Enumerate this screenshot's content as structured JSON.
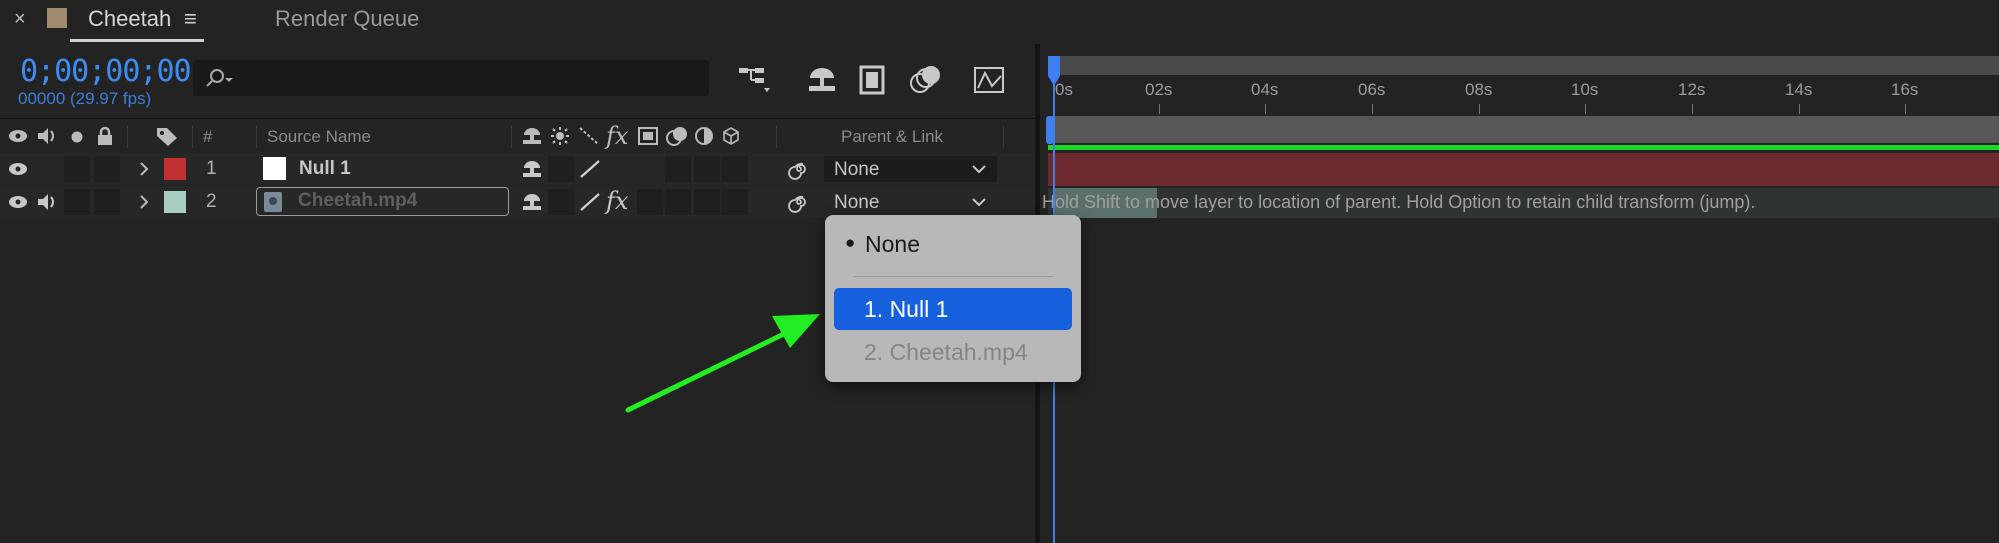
{
  "tabs": {
    "close_glyph": "×",
    "active_title": "Cheetah",
    "menu_glyph": "≡",
    "other_title": "Render Queue",
    "swatch_color": "#a08a6e"
  },
  "composition": {
    "timecode": "0;00;00;00",
    "frame_info": "00000 (29.97 fps)",
    "search_placeholder": ""
  },
  "columns": {
    "number": "#",
    "source_name": "Source Name",
    "parent_link": "Parent & Link",
    "fx": "fx"
  },
  "layers": [
    {
      "number": "1",
      "name": "Null 1",
      "label_color": "#c03030",
      "parent": "None",
      "fx": ""
    },
    {
      "number": "2",
      "name": "Cheetah.mp4",
      "label_color": "#a7cdc4",
      "parent": "None",
      "fx": "fx"
    }
  ],
  "timeline": {
    "ruler": [
      "0s",
      "02s",
      "04s",
      "06s",
      "08s",
      "10s",
      "12s",
      "14s",
      "16s"
    ],
    "hint": "Hold Shift to move layer to location of parent. Hold Option to retain child transform (jump).",
    "layer_bar_color": "#6d2a2f",
    "green_line_color": "#1fd62a"
  },
  "parent_menu": {
    "items": [
      {
        "label": "None",
        "bullet": "●",
        "state": "current"
      },
      {
        "label": "1. Null 1",
        "state": "highlighted"
      },
      {
        "label": "2. Cheetah.mp4",
        "state": "disabled"
      }
    ]
  },
  "colors": {
    "accent_blue": "#3e8cf2",
    "menu_highlight": "#1660dd",
    "arrow_green": "#22ee22"
  }
}
